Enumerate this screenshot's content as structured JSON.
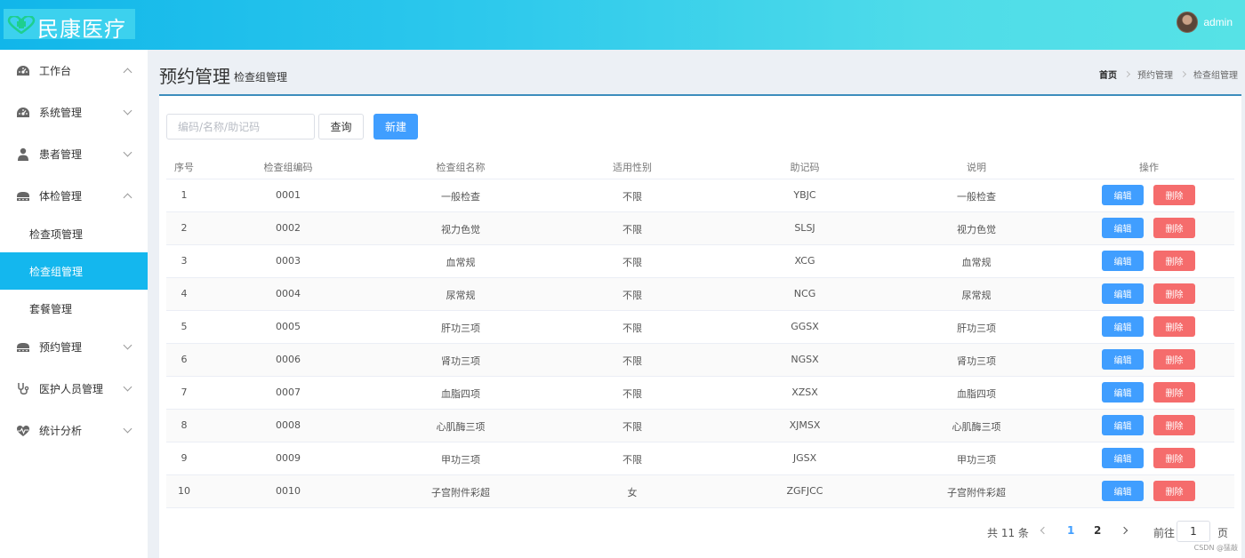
{
  "header": {
    "logo_text": "民康医疗",
    "username": "admin"
  },
  "colors": {
    "header_start": "#11b6ea",
    "header_end": "#56e2e6",
    "active_menu": "#14b7ee",
    "primary": "#409eff",
    "danger": "#f56c6c",
    "card_border": "#3c8dbc"
  },
  "sidebar": {
    "items": [
      {
        "label": "工作台",
        "icon": "dashboard-icon",
        "expanded": true
      },
      {
        "label": "系统管理",
        "icon": "dashboard-icon",
        "expanded": false
      },
      {
        "label": "患者管理",
        "icon": "user-icon",
        "expanded": false
      },
      {
        "label": "体检管理",
        "icon": "exam-icon",
        "expanded": true
      },
      {
        "label": "预约管理",
        "icon": "exam-icon",
        "expanded": false
      },
      {
        "label": "医护人员管理",
        "icon": "stethoscope-icon",
        "expanded": false
      },
      {
        "label": "统计分析",
        "icon": "heartbeat-icon",
        "expanded": false
      }
    ],
    "sub_items": [
      {
        "label": "检查项管理",
        "active": false
      },
      {
        "label": "检查组管理",
        "active": true
      },
      {
        "label": "套餐管理",
        "active": false
      }
    ]
  },
  "page": {
    "title": "预约管理",
    "subtitle": "检查组管理",
    "breadcrumb": [
      "首页",
      "预约管理",
      "检查组管理"
    ]
  },
  "toolbar": {
    "search_placeholder": "编码/名称/助记码",
    "query_label": "查询",
    "new_label": "新建"
  },
  "table": {
    "headers": [
      "序号",
      "检查组编码",
      "检查组名称",
      "适用性别",
      "助记码",
      "说明",
      "操作"
    ],
    "edit_label": "编辑",
    "delete_label": "删除",
    "rows": [
      [
        "1",
        "0001",
        "一般检查",
        "不限",
        "YBJC",
        "一般检查"
      ],
      [
        "2",
        "0002",
        "视力色觉",
        "不限",
        "SLSJ",
        "视力色觉"
      ],
      [
        "3",
        "0003",
        "血常规",
        "不限",
        "XCG",
        "血常规"
      ],
      [
        "4",
        "0004",
        "尿常规",
        "不限",
        "NCG",
        "尿常规"
      ],
      [
        "5",
        "0005",
        "肝功三项",
        "不限",
        "GGSX",
        "肝功三项"
      ],
      [
        "6",
        "0006",
        "肾功三项",
        "不限",
        "NGSX",
        "肾功三项"
      ],
      [
        "7",
        "0007",
        "血脂四项",
        "不限",
        "XZSX",
        "血脂四项"
      ],
      [
        "8",
        "0008",
        "心肌酶三项",
        "不限",
        "XJMSX",
        "心肌酶三项"
      ],
      [
        "9",
        "0009",
        "甲功三项",
        "不限",
        "JGSX",
        "甲功三项"
      ],
      [
        "10",
        "0010",
        "子宫附件彩超",
        "女",
        "ZGFJCC",
        "子宫附件彩超"
      ]
    ]
  },
  "pagination": {
    "total_text": "共 11 条",
    "pages": [
      "1",
      "2"
    ],
    "current_page": "1",
    "goto_label": "前往",
    "goto_value": "1",
    "page_unit": "页"
  },
  "watermark": "CSDN @猛敲"
}
